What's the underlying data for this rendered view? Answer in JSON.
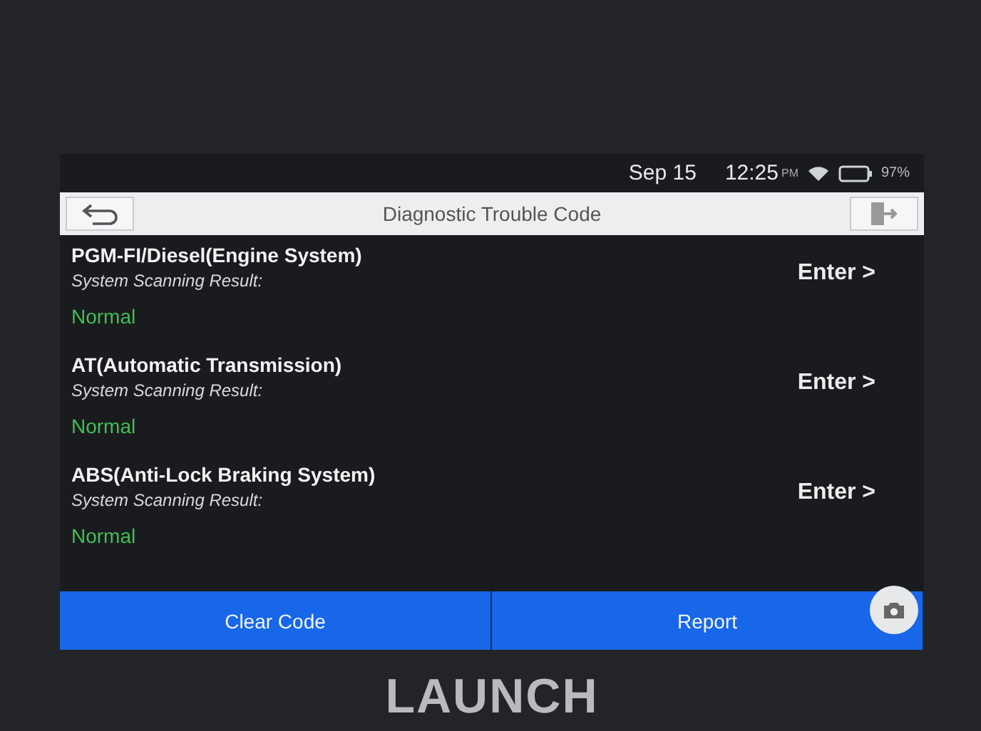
{
  "status_bar": {
    "date": "Sep 15",
    "time": "12:25",
    "meridiem": "PM",
    "battery": "97%"
  },
  "header": {
    "title": "Diagnostic Trouble Code"
  },
  "systems": [
    {
      "name": "PGM-FI/Diesel(Engine System)",
      "result_label": "System Scanning Result:",
      "result": "Normal",
      "action": "Enter >"
    },
    {
      "name": "AT(Automatic Transmission)",
      "result_label": "System Scanning Result:",
      "result": "Normal",
      "action": "Enter >"
    },
    {
      "name": "ABS(Anti-Lock Braking System)",
      "result_label": "System Scanning Result:",
      "result": "Normal",
      "action": "Enter >"
    }
  ],
  "buttons": [
    "Clear Code",
    "Report"
  ],
  "device": {
    "brand": "LAUNCH"
  }
}
